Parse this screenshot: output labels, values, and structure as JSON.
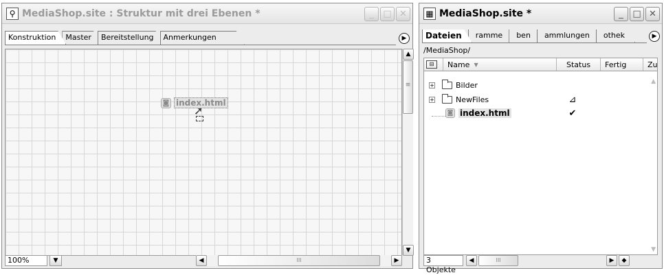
{
  "left_window": {
    "title": "MediaShop.site : Struktur mit drei Ebenen *",
    "tabs": [
      "Konstruktion",
      "Master",
      "Bereitstellung",
      "Anmerkungen"
    ],
    "active_tab": "Konstruktion",
    "node_label": "index.html",
    "zoom": "100%",
    "hscroll_grip": "III",
    "vscroll_grip": "≡"
  },
  "right_window": {
    "title": "MediaShop.site *",
    "tabs": [
      "Dateien",
      "ramme",
      "ben",
      "ammlungen",
      "othek"
    ],
    "active_tab": "Dateien",
    "path": "/MediaShop/",
    "columns": {
      "name": "Name",
      "status": "Status",
      "done": "Fertig",
      "zu": "Zu"
    },
    "files": [
      {
        "name": "Bilder",
        "status": ""
      },
      {
        "name": "NewFiles",
        "status": "⊿"
      },
      {
        "name": "index.html",
        "status": "✔"
      }
    ],
    "object_count": "3 Objekte",
    "hscroll_grip": "III"
  },
  "colors": {
    "grid": "#d7d7d7",
    "inactive_title": "#9a9a9a",
    "window_bg": "#ececec"
  }
}
